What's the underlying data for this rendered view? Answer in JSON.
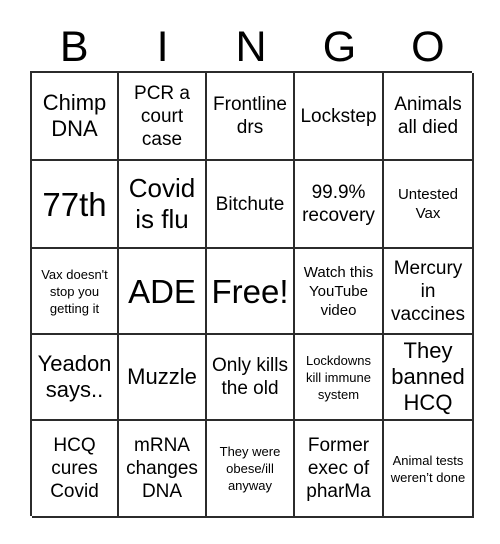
{
  "card": {
    "title": "BINGO",
    "header_letters": [
      "B",
      "I",
      "N",
      "G",
      "O"
    ],
    "grid_size": "5x5",
    "colors": {
      "background": "#ffffff",
      "text": "#000000",
      "grid_line": "#2b2b2b"
    },
    "rows": [
      [
        {
          "text": "Chimp DNA",
          "size": "lg"
        },
        {
          "text": "PCR a court case",
          "size": "md"
        },
        {
          "text": "Frontline drs",
          "size": "md"
        },
        {
          "text": "Lockstep",
          "size": "md"
        },
        {
          "text": "Animals all died",
          "size": "md"
        }
      ],
      [
        {
          "text": "77th",
          "size": "xxl"
        },
        {
          "text": "Covid is flu",
          "size": "xl"
        },
        {
          "text": "Bitchute",
          "size": "md"
        },
        {
          "text": "99.9% recovery",
          "size": "md"
        },
        {
          "text": "Untested Vax",
          "size": "sm"
        }
      ],
      [
        {
          "text": "Vax doesn't stop you getting it",
          "size": "xs"
        },
        {
          "text": "ADE",
          "size": "xxl"
        },
        {
          "text": "Free!",
          "size": "xxl"
        },
        {
          "text": "Watch this YouTube video",
          "size": "sm"
        },
        {
          "text": "Mercury in vaccines",
          "size": "md"
        }
      ],
      [
        {
          "text": "Yeadon says..",
          "size": "lg"
        },
        {
          "text": "Muzzle",
          "size": "lg"
        },
        {
          "text": "Only kills the old",
          "size": "md"
        },
        {
          "text": "Lockdowns kill immune system",
          "size": "xs"
        },
        {
          "text": "They banned HCQ",
          "size": "lg"
        }
      ],
      [
        {
          "text": "HCQ cures Covid",
          "size": "md"
        },
        {
          "text": "mRNA changes DNA",
          "size": "md"
        },
        {
          "text": "They were obese/ill anyway",
          "size": "xs"
        },
        {
          "text": "Former exec of pharMa",
          "size": "md"
        },
        {
          "text": "Animal tests weren’t done",
          "size": "xs"
        }
      ]
    ]
  }
}
